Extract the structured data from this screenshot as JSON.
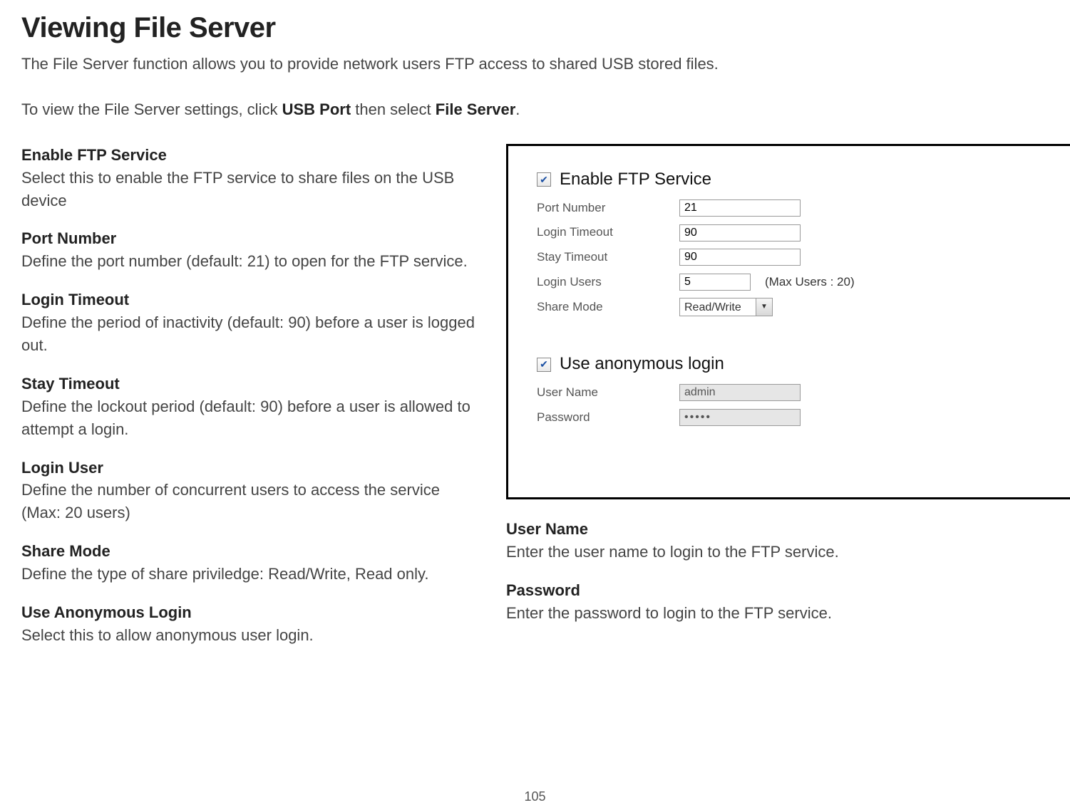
{
  "heading": "Viewing File Server",
  "intro_part1": "The File Server function allows you to provide network users FTP access to shared USB stored files.",
  "intro_nav_pre": "To view the File Server settings, click ",
  "intro_nav_b1": "USB Port",
  "intro_nav_mid": " then select ",
  "intro_nav_b2": "File Server",
  "intro_nav_post": ".",
  "defs": {
    "enable_ftp": {
      "term": "Enable FTP Service",
      "desc": "Select this to enable the FTP service to share files on the USB device"
    },
    "port_number": {
      "term": "Port Number",
      "desc": "Define the port number (default: 21) to open for the FTP service."
    },
    "login_timeout": {
      "term": "Login Timeout",
      "desc": "Define the period of inactivity (default: 90) before a user is logged out."
    },
    "stay_timeout": {
      "term": "Stay Timeout",
      "desc": "Define the lockout period (default: 90) before a user is allowed to attempt a login."
    },
    "login_user": {
      "term": "Login User",
      "desc": "Define the number of concurrent users to access the service (Max: 20 users)"
    },
    "share_mode": {
      "term": "Share Mode",
      "desc": "Define the type of share priviledge: Read/Write, Read only."
    },
    "anon": {
      "term": "Use Anonymous Login",
      "desc": "Select this to allow anonymous user login."
    },
    "user_name": {
      "term": "User Name",
      "desc": "Enter the user name to login to the FTP service."
    },
    "password": {
      "term": "Password",
      "desc": "Enter the password to login to the FTP service."
    }
  },
  "panel": {
    "enable_ftp_label": "Enable FTP Service",
    "port_number_label": "Port Number",
    "port_number_value": "21",
    "login_timeout_label": "Login Timeout",
    "login_timeout_value": "90",
    "stay_timeout_label": "Stay Timeout",
    "stay_timeout_value": "90",
    "login_users_label": "Login Users",
    "login_users_value": "5",
    "login_users_hint": "(Max Users : 20)",
    "share_mode_label": "Share Mode",
    "share_mode_value": "Read/Write",
    "anon_label": "Use anonymous login",
    "user_name_label": "User Name",
    "user_name_value": "admin",
    "password_label": "Password",
    "password_value": "•••••"
  },
  "page_number": "105"
}
